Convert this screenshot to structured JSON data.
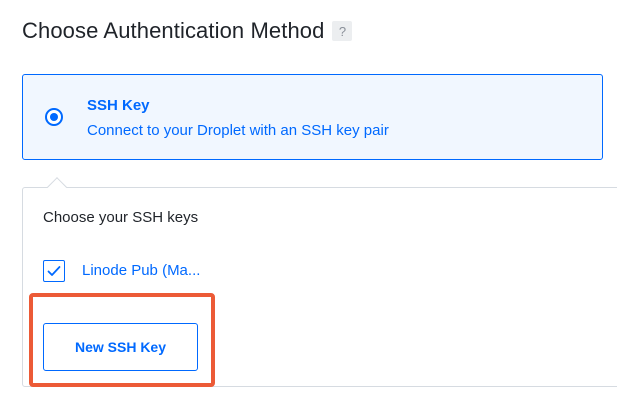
{
  "header": {
    "title": "Choose Authentication Method",
    "help_icon": "help-icon",
    "help_glyph": "?"
  },
  "auth_option": {
    "title": "SSH Key",
    "description": "Connect to your Droplet with an SSH key pair",
    "selected": true
  },
  "ssh_keys": {
    "label": "Choose your SSH keys",
    "keys": [
      {
        "name": "Linode Pub (Ma...",
        "checked": true
      }
    ],
    "new_key_button": "New SSH Key"
  },
  "colors": {
    "accent": "#0069ff",
    "selected_bg": "#f1f7ff",
    "highlight": "#ec5a36",
    "border": "#d6dbe1"
  }
}
